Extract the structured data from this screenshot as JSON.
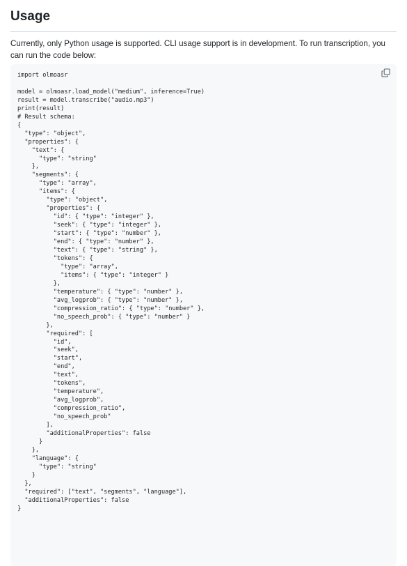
{
  "section": {
    "title": "Usage",
    "description": "Currently, only Python usage is supported. CLI usage support is in development. To run transcription, you can run the code below:"
  },
  "code_block": {
    "icons": {
      "copy": "copy-icon"
    },
    "lines": [
      "import olmoasr",
      "",
      "model = olmoasr.load_model(\"medium\", inference=True)",
      "result = model.transcribe(\"audio.mp3\")",
      "print(result)",
      "# Result schema:",
      "{",
      "  \"type\": \"object\",",
      "  \"properties\": {",
      "    \"text\": {",
      "      \"type\": \"string\"",
      "    },",
      "    \"segments\": {",
      "      \"type\": \"array\",",
      "      \"items\": {",
      "        \"type\": \"object\",",
      "        \"properties\": {",
      "          \"id\": { \"type\": \"integer\" },",
      "          \"seek\": { \"type\": \"integer\" },",
      "          \"start\": { \"type\": \"number\" },",
      "          \"end\": { \"type\": \"number\" },",
      "          \"text\": { \"type\": \"string\" },",
      "          \"tokens\": {",
      "            \"type\": \"array\",",
      "            \"items\": { \"type\": \"integer\" }",
      "          },",
      "          \"temperature\": { \"type\": \"number\" },",
      "          \"avg_logprob\": { \"type\": \"number\" },",
      "          \"compression_ratio\": { \"type\": \"number\" },",
      "          \"no_speech_prob\": { \"type\": \"number\" }",
      "        },",
      "        \"required\": [",
      "          \"id\",",
      "          \"seek\",",
      "          \"start\",",
      "          \"end\",",
      "          \"text\",",
      "          \"tokens\",",
      "          \"temperature\",",
      "          \"avg_logprob\",",
      "          \"compression_ratio\",",
      "          \"no_speech_prob\"",
      "        ],",
      "        \"additionalProperties\": false",
      "      }",
      "    },",
      "    \"language\": {",
      "      \"type\": \"string\"",
      "    }",
      "  },",
      "  \"required\": [\"text\", \"segments\", \"language\"],",
      "  \"additionalProperties\": false",
      "}"
    ]
  }
}
